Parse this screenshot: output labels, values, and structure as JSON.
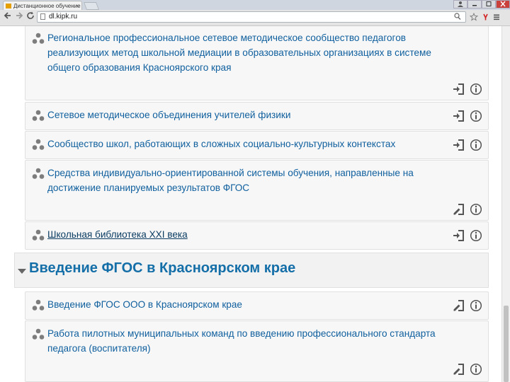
{
  "browser": {
    "tab_title": "Дистанционное обучение",
    "tab_close": "×",
    "address": "dl.kipk.ru"
  },
  "modules": [
    {
      "title": "Региональное профессиональное сетевое методическое сообщество педагогов реализующих метод школьной медиации в образовательных организациях в системе общего образования Красноярского края"
    },
    {
      "title": "Сетевое методическое объединения учителей физики"
    },
    {
      "title": "Сообщество школ, работающих в сложных социально-культурных контекстах"
    },
    {
      "title": "Средства индивидуально-ориентированной системы обучения, направленные на достижение планируемых результатов ФГОС"
    },
    {
      "title": "Школьная библиотека XXI века"
    }
  ],
  "section": {
    "title": "Введение ФГОС в Красноярском крае"
  },
  "section_modules": [
    {
      "title": "Введение ФГОС ООО в Красноярском крае"
    },
    {
      "title": "Работа пилотных муниципальных команд по введению профессионального стандарта педагога (воспитателя)"
    }
  ]
}
